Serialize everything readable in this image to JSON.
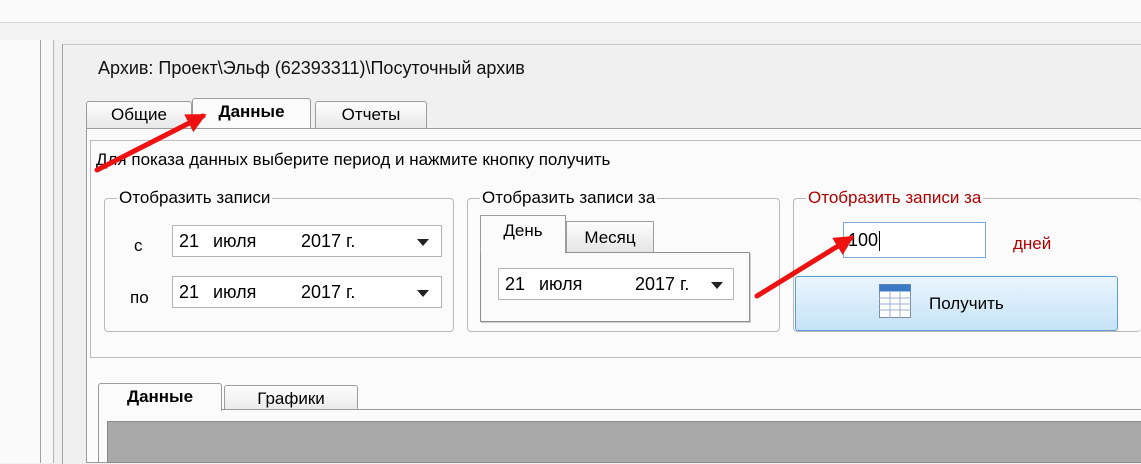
{
  "window": {
    "title": "Архив: Проект\\Эльф (62393311)\\Посуточный архив"
  },
  "tabs": [
    {
      "label": "Общие"
    },
    {
      "label": "Данные"
    },
    {
      "label": "Отчеты"
    }
  ],
  "hint": "Для показа данных выберите период и нажмите кнопку получить",
  "records_group": {
    "legend": "Отобразить записи",
    "from_label": "с",
    "to_label": "по",
    "from_date": {
      "day": "21",
      "month": "июля",
      "year": "2017 г."
    },
    "to_date": {
      "day": "21",
      "month": "июля",
      "year": "2017 г."
    }
  },
  "for_group": {
    "legend": "Отобразить записи за",
    "tabs": [
      {
        "label": "День"
      },
      {
        "label": "Месяц"
      }
    ],
    "date": {
      "day": "21",
      "month": "июля",
      "year": "2017 г."
    }
  },
  "days_group": {
    "legend": "Отобразить записи за",
    "value": "100",
    "unit": "дней",
    "get_button": "Получить",
    "accent_color": "#b00000"
  },
  "bottom_tabs": [
    {
      "label": "Данные"
    },
    {
      "label": "Графики"
    }
  ],
  "annotation_color": "#ee1111",
  "icons": {
    "get": "table-icon",
    "dropdown": "caret-down-icon"
  }
}
